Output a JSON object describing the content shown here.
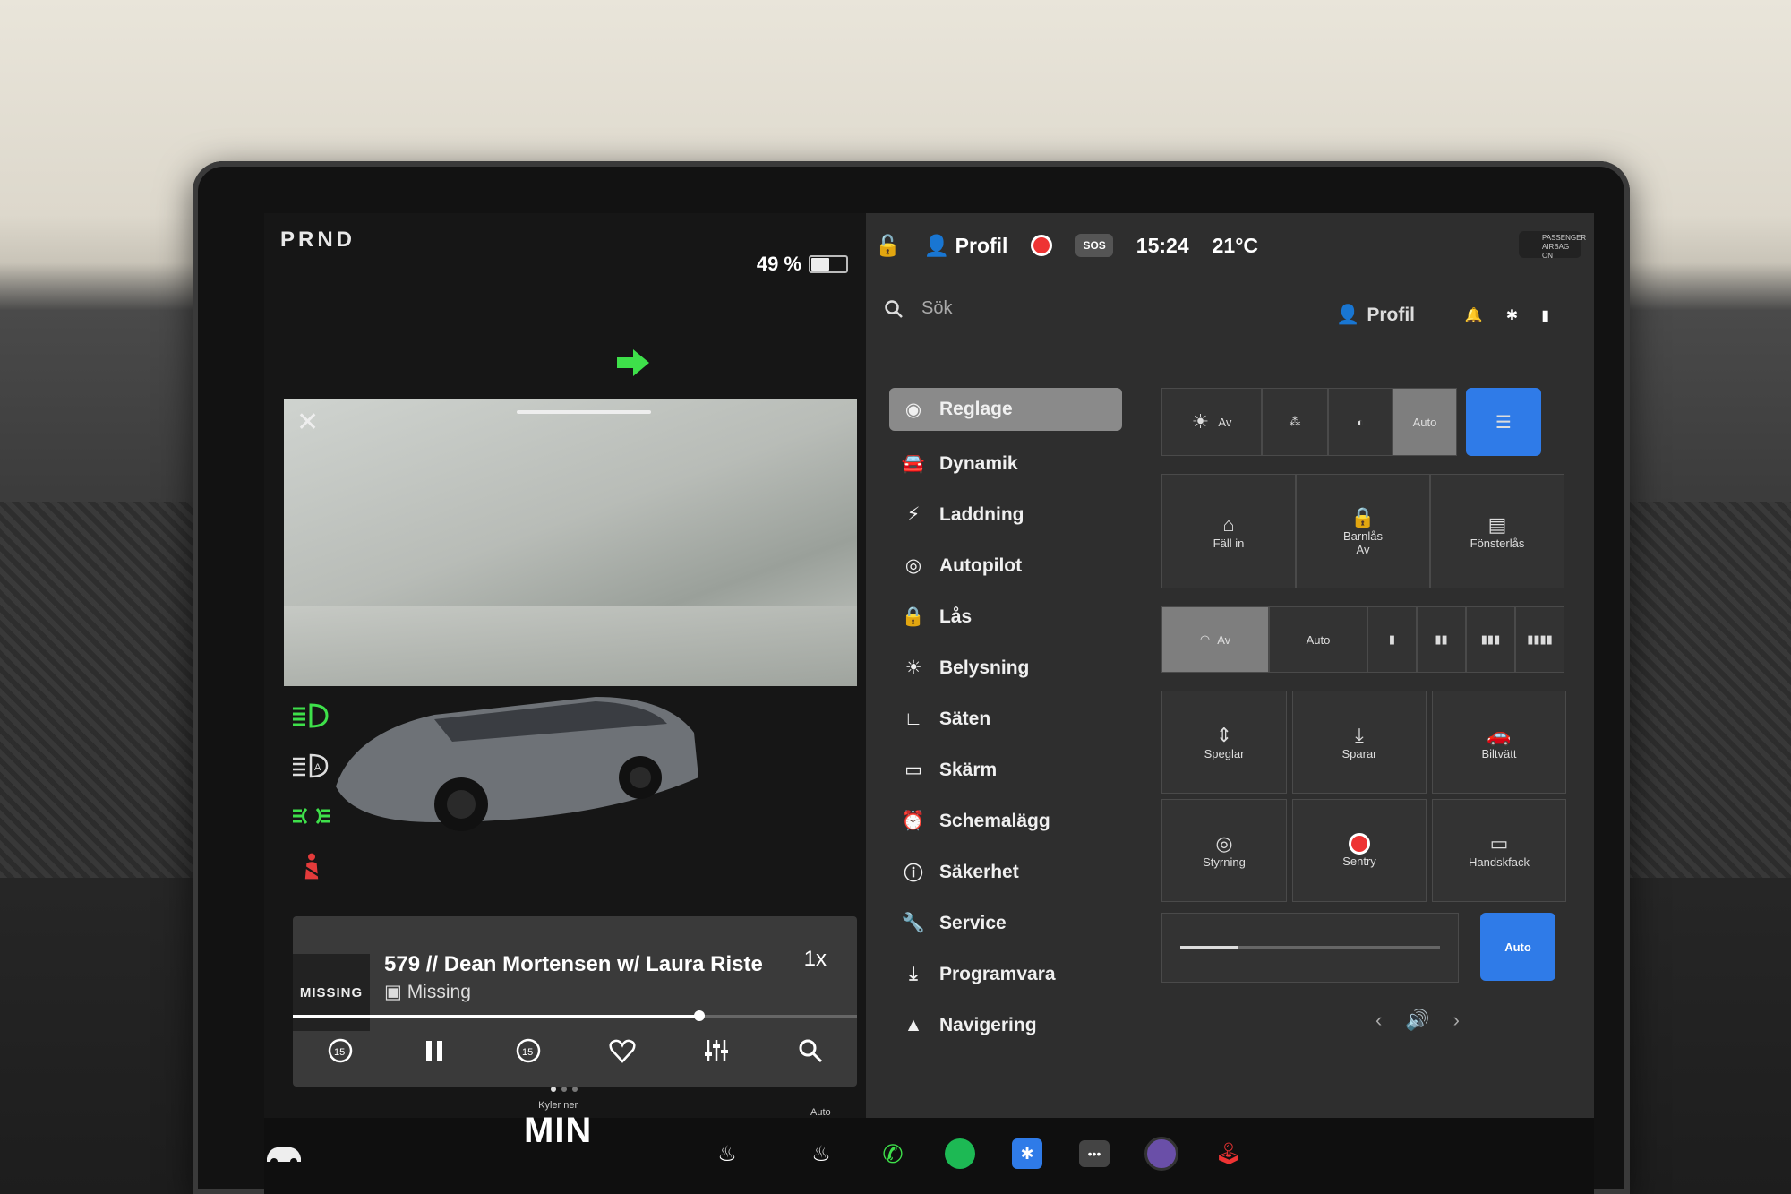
{
  "left": {
    "gear": "PRND",
    "battery_pct": "49 %",
    "battery_level": 0.49,
    "media": {
      "album_label": "MISSING",
      "title": "579 // Dean Mortensen w/ Laura Riste",
      "subtitle": "Missing",
      "speed": "1x",
      "progress": 0.72
    }
  },
  "status": {
    "profile": "Profil",
    "sos": "SOS",
    "time": "15:24",
    "temp": "21°C",
    "airbag": "PASSENGER AIRBAG ON"
  },
  "search": {
    "placeholder": "Sök",
    "profile": "Profil"
  },
  "menu": [
    {
      "label": "Reglage",
      "icon": "toggle-icon"
    },
    {
      "label": "Dynamik",
      "icon": "car-icon"
    },
    {
      "label": "Laddning",
      "icon": "bolt-icon"
    },
    {
      "label": "Autopilot",
      "icon": "steering-icon"
    },
    {
      "label": "Lås",
      "icon": "lock-icon"
    },
    {
      "label": "Belysning",
      "icon": "sun-icon"
    },
    {
      "label": "Säten",
      "icon": "seat-icon"
    },
    {
      "label": "Skärm",
      "icon": "display-icon"
    },
    {
      "label": "Schemalägg",
      "icon": "alarm-icon"
    },
    {
      "label": "Säkerhet",
      "icon": "safety-icon"
    },
    {
      "label": "Service",
      "icon": "wrench-icon"
    },
    {
      "label": "Programvara",
      "icon": "download-icon"
    },
    {
      "label": "Navigering",
      "icon": "nav-icon"
    }
  ],
  "controls": {
    "lights_off": "Av",
    "lights_auto": "Auto",
    "fold": "Fäll in",
    "childlock": "Barnlås",
    "childlock_sub": "Av",
    "windowlock": "Fönsterlås",
    "wiper_off": "Av",
    "wiper_auto": "Auto",
    "mirrors": "Speglar",
    "save": "Sparar",
    "carwash": "Biltvätt",
    "steering": "Styrning",
    "sentry": "Sentry",
    "glovebox": "Handskfack",
    "brightness_auto": "Auto",
    "brightness_level": 0.22
  },
  "dock": {
    "climate_status": "Kyler ner",
    "climate_value": "MIN",
    "seat_heat_label": "Auto"
  },
  "colors": {
    "accent": "#2f7be8",
    "indicator_green": "#3ee04a",
    "seatbelt_red": "#e43b3b"
  }
}
